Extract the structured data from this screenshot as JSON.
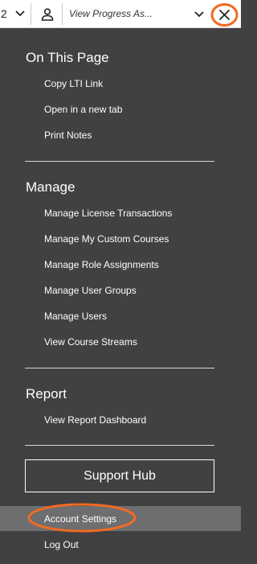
{
  "topbar": {
    "number": "2",
    "view_progress_placeholder": "View Progress As...",
    "icons": {
      "dropdown": "chevron-down-icon",
      "user": "user-icon",
      "close": "close-icon"
    }
  },
  "menu": {
    "on_this_page": {
      "title": "On This Page",
      "items": [
        "Copy LTI Link",
        "Open in a new tab",
        "Print Notes"
      ]
    },
    "manage": {
      "title": "Manage",
      "items": [
        "Manage License Transactions",
        "Manage My Custom Courses",
        "Manage Role Assignments",
        "Manage User Groups",
        "Manage Users",
        "View Course Streams"
      ]
    },
    "report": {
      "title": "Report",
      "items": [
        "View Report Dashboard"
      ]
    },
    "support_hub": "Support Hub",
    "account_settings": "Account Settings",
    "log_out": "Log Out"
  },
  "colors": {
    "background": "#414042",
    "highlight_row": "#6d6e70",
    "annotation": "#f26a21"
  }
}
